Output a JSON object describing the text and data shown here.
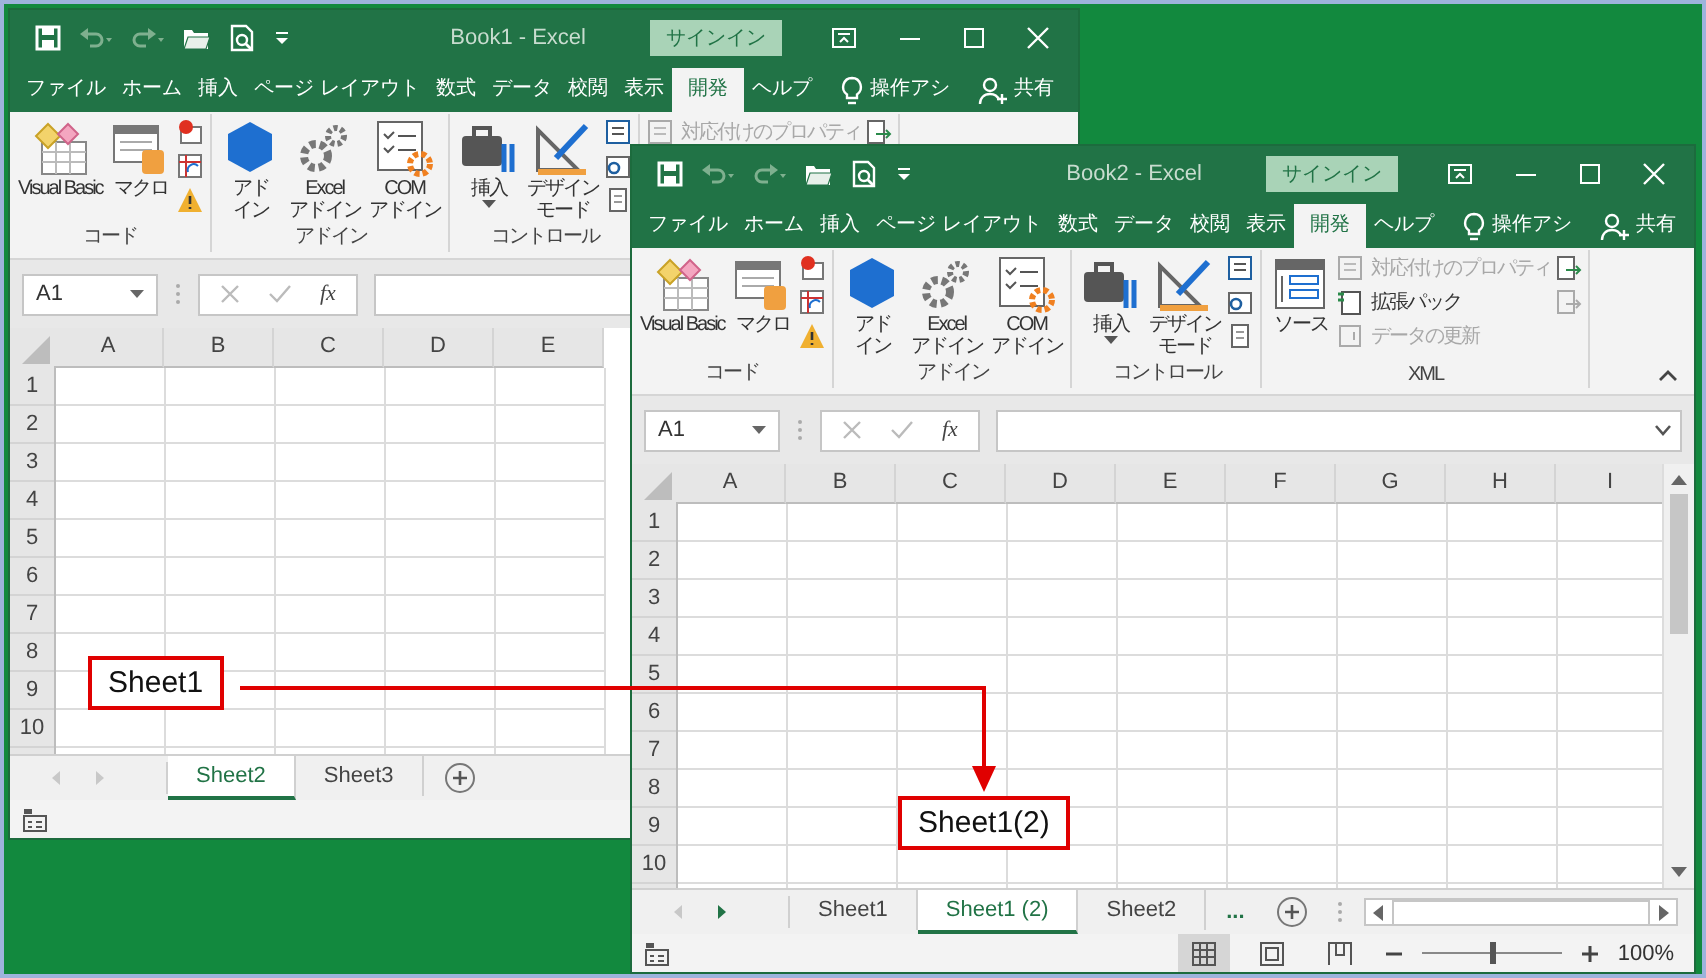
{
  "windows": [
    {
      "title": "Book1 - Excel",
      "signin": "サインイン",
      "tabs": [
        {
          "kind": "tab",
          "label": "ファイル",
          "selected": false
        },
        {
          "kind": "tab",
          "label": "ホーム",
          "selected": false
        },
        {
          "kind": "tab",
          "label": "挿入",
          "selected": false
        },
        {
          "kind": "tab",
          "label": "ページ レイアウト",
          "selected": false
        },
        {
          "kind": "tab",
          "label": "数式",
          "selected": false
        },
        {
          "kind": "tab",
          "label": "データ",
          "selected": false
        },
        {
          "kind": "tab",
          "label": "校閲",
          "selected": false
        },
        {
          "kind": "tab",
          "label": "表示",
          "selected": false
        },
        {
          "kind": "tab",
          "label": "開発",
          "selected": true
        },
        {
          "kind": "tab",
          "label": "ヘルプ",
          "selected": false
        },
        {
          "kind": "search",
          "label": "操作アシ",
          "selected": false
        },
        {
          "kind": "share",
          "label": "共有",
          "selected": false
        }
      ],
      "ribbon": {
        "groups": [
          {
            "label": "コード",
            "items": [
              {
                "kind": "large",
                "lines": [
                  "Visual Basic"
                ],
                "dropdown": false
              },
              {
                "kind": "large",
                "lines": [
                  "マクロ"
                ],
                "dropdown": false
              },
              {
                "kind": "stack",
                "items": [
                  {
                    "kind": "icon"
                  },
                  {
                    "kind": "icon"
                  },
                  {
                    "kind": "icon"
                  }
                ]
              }
            ]
          },
          {
            "label": "アドイン",
            "items": [
              {
                "kind": "large",
                "lines": [
                  "アド",
                  "イン"
                ],
                "dropdown": false
              },
              {
                "kind": "large",
                "lines": [
                  "Excel",
                  "アドイン"
                ],
                "dropdown": false
              },
              {
                "kind": "large",
                "lines": [
                  "COM",
                  "アドイン"
                ],
                "dropdown": false
              }
            ]
          },
          {
            "label": "コントロール",
            "items": [
              {
                "kind": "large",
                "lines": [
                  "挿入"
                ],
                "dropdown": true
              },
              {
                "kind": "large",
                "lines": [
                  "デザイン",
                  "モード"
                ],
                "dropdown": false
              },
              {
                "kind": "stack",
                "items": [
                  {
                    "kind": "icon"
                  },
                  {
                    "kind": "icon"
                  },
                  {
                    "kind": "icon"
                  }
                ]
              }
            ]
          },
          {
            "items": [
              {
                "kind": "stack",
                "items": [
                  {
                    "kind": "small",
                    "label": "対応付けのプロパティ",
                    "disabled": true
                  }
                ]
              },
              {
                "kind": "stack",
                "items": [
                  {
                    "kind": "icon"
                  }
                ]
              }
            ]
          }
        ]
      },
      "formula_bar": {
        "name_box": "A1",
        "function_button": "fx"
      },
      "columns": [
        "A",
        "B",
        "C",
        "D",
        "E"
      ],
      "rows": [
        "1",
        "2",
        "3",
        "4",
        "5",
        "6",
        "7",
        "8",
        "9",
        "10"
      ],
      "sheet_tabs": [
        {
          "label": "Sheet2",
          "selected": true
        },
        {
          "label": "Sheet3",
          "selected": false
        }
      ]
    },
    {
      "title": "Book2 - Excel",
      "signin": "サインイン",
      "tabs": [
        {
          "kind": "tab",
          "label": "ファイル",
          "selected": false
        },
        {
          "kind": "tab",
          "label": "ホーム",
          "selected": false
        },
        {
          "kind": "tab",
          "label": "挿入",
          "selected": false
        },
        {
          "kind": "tab",
          "label": "ページ レイアウト",
          "selected": false
        },
        {
          "kind": "tab",
          "label": "数式",
          "selected": false
        },
        {
          "kind": "tab",
          "label": "データ",
          "selected": false
        },
        {
          "kind": "tab",
          "label": "校閲",
          "selected": false
        },
        {
          "kind": "tab",
          "label": "表示",
          "selected": false
        },
        {
          "kind": "tab",
          "label": "開発",
          "selected": true
        },
        {
          "kind": "tab",
          "label": "ヘルプ",
          "selected": false
        },
        {
          "kind": "search",
          "label": "操作アシ",
          "selected": false
        },
        {
          "kind": "share",
          "label": "共有",
          "selected": false
        }
      ],
      "ribbon": {
        "groups": [
          {
            "label": "コード",
            "items": [
              {
                "kind": "large",
                "lines": [
                  "Visual Basic"
                ],
                "dropdown": false
              },
              {
                "kind": "large",
                "lines": [
                  "マクロ"
                ],
                "dropdown": false
              },
              {
                "kind": "stack",
                "items": [
                  {
                    "kind": "icon"
                  },
                  {
                    "kind": "icon"
                  },
                  {
                    "kind": "icon"
                  }
                ]
              }
            ]
          },
          {
            "label": "アドイン",
            "items": [
              {
                "kind": "large",
                "lines": [
                  "アド",
                  "イン"
                ],
                "dropdown": false
              },
              {
                "kind": "large",
                "lines": [
                  "Excel",
                  "アドイン"
                ],
                "dropdown": false
              },
              {
                "kind": "large",
                "lines": [
                  "COM",
                  "アドイン"
                ],
                "dropdown": false
              }
            ]
          },
          {
            "label": "コントロール",
            "items": [
              {
                "kind": "large",
                "lines": [
                  "挿入"
                ],
                "dropdown": true
              },
              {
                "kind": "large",
                "lines": [
                  "デザイン",
                  "モード"
                ],
                "dropdown": false
              },
              {
                "kind": "stack",
                "items": [
                  {
                    "kind": "icon"
                  },
                  {
                    "kind": "icon"
                  },
                  {
                    "kind": "icon"
                  }
                ]
              }
            ]
          },
          {
            "label": "XML",
            "items": [
              {
                "kind": "large",
                "lines": [
                  "ソース"
                ],
                "dropdown": false
              },
              {
                "kind": "stack",
                "items": [
                  {
                    "kind": "small",
                    "label": "対応付けのプロパティ",
                    "disabled": true
                  },
                  {
                    "kind": "small",
                    "label": "拡張パック",
                    "disabled": false
                  },
                  {
                    "kind": "small",
                    "label": "データの更新",
                    "disabled": true
                  }
                ]
              },
              {
                "kind": "stack",
                "items": [
                  {
                    "kind": "icon"
                  },
                  {
                    "kind": "icon"
                  }
                ]
              }
            ]
          }
        ]
      },
      "formula_bar": {
        "name_box": "A1",
        "function_button": "fx"
      },
      "columns": [
        "A",
        "B",
        "C",
        "D",
        "E",
        "F",
        "G",
        "H",
        "I"
      ],
      "rows": [
        "1",
        "2",
        "3",
        "4",
        "5",
        "6",
        "7",
        "8",
        "9",
        "10"
      ],
      "sheet_tabs": [
        {
          "label": "Sheet1",
          "selected": false
        },
        {
          "label": "Sheet1 (2)",
          "selected": true
        },
        {
          "label": "Sheet2",
          "selected": false
        }
      ],
      "more_sheets": "...",
      "status_bar": {
        "views": [
          {
            "selected": true
          },
          {
            "selected": false
          },
          {
            "selected": false
          }
        ],
        "zoom": {
          "level": 0.5,
          "reading": "100%"
        }
      }
    }
  ],
  "annotations": [
    {
      "text": "Sheet1"
    },
    {
      "text": "Sheet1(2)"
    }
  ]
}
